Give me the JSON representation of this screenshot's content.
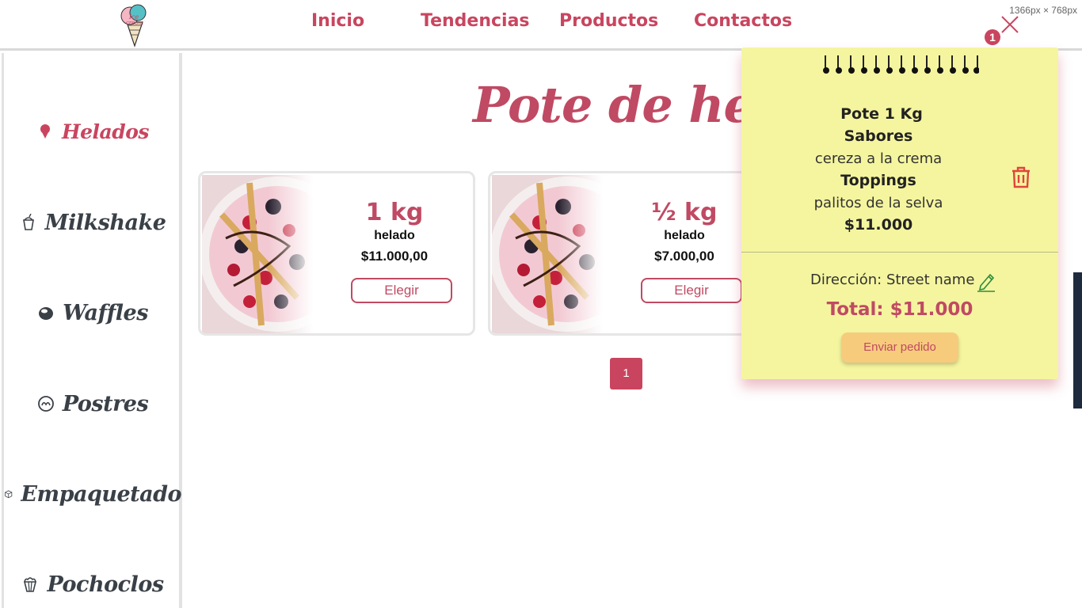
{
  "header": {
    "logo_text": "Ice Cream",
    "nav": [
      "Inicio",
      "Tendencias",
      "Productos",
      "Contactos"
    ],
    "dims_label": "1366px × 768px",
    "cart_count": "1"
  },
  "sidebar": {
    "items": [
      {
        "label": "Helados",
        "icon": "ice-cream-icon"
      },
      {
        "label": "Milkshake",
        "icon": "milkshake-icon"
      },
      {
        "label": "Waffles",
        "icon": "waffle-icon"
      },
      {
        "label": "Postres",
        "icon": "dessert-icon"
      },
      {
        "label": "Empaquetado",
        "icon": "box-icon"
      },
      {
        "label": "Pochoclos",
        "icon": "popcorn-icon"
      }
    ],
    "active": "Helados"
  },
  "main": {
    "title": "Pote de helado",
    "products": [
      {
        "size": "1 kg",
        "kind": "helado",
        "price": "$11.000,00",
        "button": "Elegir"
      },
      {
        "size": "½ kg",
        "kind": "helado",
        "price": "$7.000,00",
        "button": "Elegir"
      }
    ],
    "pagination": [
      "1"
    ]
  },
  "cart": {
    "item_name": "Pote 1 Kg",
    "flavors_label": "Sabores",
    "flavors_value": "cereza a la crema",
    "toppings_label": "Toppings",
    "toppings_value": "palitos de la selva",
    "item_price": "$11.000",
    "address": "Dirección: Street name",
    "total": "Total: $11.000",
    "send_button": "Enviar pedido"
  },
  "colors": {
    "accent": "#c9455f",
    "cart_bg": "#f5f59f",
    "send_bg": "#f6cc7c",
    "trash": "#e0443a",
    "edit": "#2e8b3d"
  }
}
